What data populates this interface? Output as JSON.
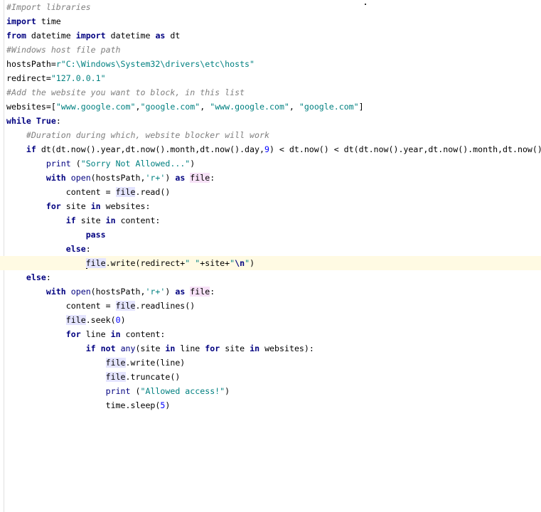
{
  "editor": {
    "current_line": 19,
    "lines": [
      [
        {
          "t": "#Import libraries",
          "c": "cm"
        }
      ],
      [
        {
          "t": "import",
          "c": "kw"
        },
        {
          "t": " time"
        }
      ],
      [
        {
          "t": "from",
          "c": "kw"
        },
        {
          "t": " datetime "
        },
        {
          "t": "import",
          "c": "kw"
        },
        {
          "t": " datetime "
        },
        {
          "t": "as",
          "c": "kw"
        },
        {
          "t": " dt"
        }
      ],
      [
        {
          "t": "#Windows host file path",
          "c": "cm"
        }
      ],
      [
        {
          "t": "hostsPath="
        },
        {
          "t": "r\"C:\\Windows\\System32\\drivers\\etc\\hosts\"",
          "c": "str"
        }
      ],
      [
        {
          "t": "redirect="
        },
        {
          "t": "\"127.0.0.1\"",
          "c": "str"
        }
      ],
      [
        {
          "t": "#Add the website you want to block, in this list",
          "c": "cm"
        }
      ],
      [
        {
          "t": "websites=["
        },
        {
          "t": "\"www.google.com\"",
          "c": "str"
        },
        {
          "t": ","
        },
        {
          "t": "\"google.com\"",
          "c": "str"
        },
        {
          "t": ", "
        },
        {
          "t": "\"www.google.com\"",
          "c": "str"
        },
        {
          "t": ", "
        },
        {
          "t": "\"google.com\"",
          "c": "str"
        },
        {
          "t": "]"
        }
      ],
      [
        {
          "t": "while",
          "c": "kw"
        },
        {
          "t": " "
        },
        {
          "t": "True",
          "c": "kw"
        },
        {
          "t": ":"
        }
      ],
      [
        {
          "t": "    "
        },
        {
          "t": "#Duration during which, website blocker will work",
          "c": "cm"
        }
      ],
      [
        {
          "t": "    "
        },
        {
          "t": "if",
          "c": "kw"
        },
        {
          "t": " dt(dt.now().year,dt.now().month,dt.now().day,"
        },
        {
          "t": "9",
          "c": "num"
        },
        {
          "t": ") < dt.now() < dt(dt.now().year,dt.now().month,dt.now()"
        }
      ],
      [
        {
          "t": "        "
        },
        {
          "t": "print",
          "c": "bi"
        },
        {
          "t": " ("
        },
        {
          "t": "\"Sorry Not Allowed...\"",
          "c": "str"
        },
        {
          "t": ")"
        }
      ],
      [
        {
          "t": "        "
        },
        {
          "t": "with",
          "c": "kw"
        },
        {
          "t": " "
        },
        {
          "t": "open",
          "c": "bi"
        },
        {
          "t": "(hostsPath,"
        },
        {
          "t": "'r+'",
          "c": "str"
        },
        {
          "t": ") "
        },
        {
          "t": "as",
          "c": "kw"
        },
        {
          "t": " "
        },
        {
          "t": "file",
          "c": "hlw"
        },
        {
          "t": ":"
        }
      ],
      [
        {
          "t": "            content = "
        },
        {
          "t": "file",
          "c": "hl"
        },
        {
          "t": ".read()"
        }
      ],
      [
        {
          "t": "        "
        },
        {
          "t": "for",
          "c": "kw"
        },
        {
          "t": " site "
        },
        {
          "t": "in",
          "c": "kw"
        },
        {
          "t": " websites:"
        }
      ],
      [
        {
          "t": "            "
        },
        {
          "t": "if",
          "c": "kw"
        },
        {
          "t": " site "
        },
        {
          "t": "in",
          "c": "kw"
        },
        {
          "t": " content:"
        }
      ],
      [
        {
          "t": "                "
        },
        {
          "t": "pass",
          "c": "kw"
        }
      ],
      [
        {
          "t": "            "
        },
        {
          "t": "else",
          "c": "kw"
        },
        {
          "t": ":"
        }
      ],
      [
        {
          "t": "                "
        },
        {
          "t": "",
          "c": "caret"
        },
        {
          "t": "file",
          "c": "hl"
        },
        {
          "t": ".write(redirect+"
        },
        {
          "t": "\" \"",
          "c": "str"
        },
        {
          "t": "+site+"
        },
        {
          "t": "\"",
          "c": "str"
        },
        {
          "t": "\\n",
          "c": "esc"
        },
        {
          "t": "\"",
          "c": "str"
        },
        {
          "t": ")"
        }
      ],
      [
        {
          "t": "    "
        },
        {
          "t": "else",
          "c": "kw"
        },
        {
          "t": ":"
        }
      ],
      [
        {
          "t": "        "
        },
        {
          "t": "with",
          "c": "kw"
        },
        {
          "t": " "
        },
        {
          "t": "open",
          "c": "bi"
        },
        {
          "t": "(hostsPath,"
        },
        {
          "t": "'r+'",
          "c": "str"
        },
        {
          "t": ") "
        },
        {
          "t": "as",
          "c": "kw"
        },
        {
          "t": " "
        },
        {
          "t": "file",
          "c": "hlw"
        },
        {
          "t": ":"
        }
      ],
      [
        {
          "t": "            content = "
        },
        {
          "t": "file",
          "c": "hl"
        },
        {
          "t": ".readlines()"
        }
      ],
      [
        {
          "t": "            "
        },
        {
          "t": "file",
          "c": "hl"
        },
        {
          "t": ".seek("
        },
        {
          "t": "0",
          "c": "num"
        },
        {
          "t": ")"
        }
      ],
      [
        {
          "t": "            "
        },
        {
          "t": "for",
          "c": "kw"
        },
        {
          "t": " line "
        },
        {
          "t": "in",
          "c": "kw"
        },
        {
          "t": " content:"
        }
      ],
      [
        {
          "t": "                "
        },
        {
          "t": "if",
          "c": "kw"
        },
        {
          "t": " "
        },
        {
          "t": "not",
          "c": "kw"
        },
        {
          "t": " "
        },
        {
          "t": "any",
          "c": "bi"
        },
        {
          "t": "(site "
        },
        {
          "t": "in",
          "c": "kw"
        },
        {
          "t": " line "
        },
        {
          "t": "for",
          "c": "kw"
        },
        {
          "t": " site "
        },
        {
          "t": "in",
          "c": "kw"
        },
        {
          "t": " websites):"
        }
      ],
      [
        {
          "t": "                    "
        },
        {
          "t": "file",
          "c": "hl"
        },
        {
          "t": ".write(line)"
        }
      ],
      [
        {
          "t": "                    "
        },
        {
          "t": "file",
          "c": "hl"
        },
        {
          "t": ".truncate()"
        }
      ],
      [
        {
          "t": "                    "
        },
        {
          "t": "print",
          "c": "bi"
        },
        {
          "t": " ("
        },
        {
          "t": "\"Allowed access!\"",
          "c": "str"
        },
        {
          "t": ")"
        }
      ],
      [
        {
          "t": "                    time.sleep("
        },
        {
          "t": "5",
          "c": "num"
        },
        {
          "t": ")"
        }
      ]
    ]
  }
}
